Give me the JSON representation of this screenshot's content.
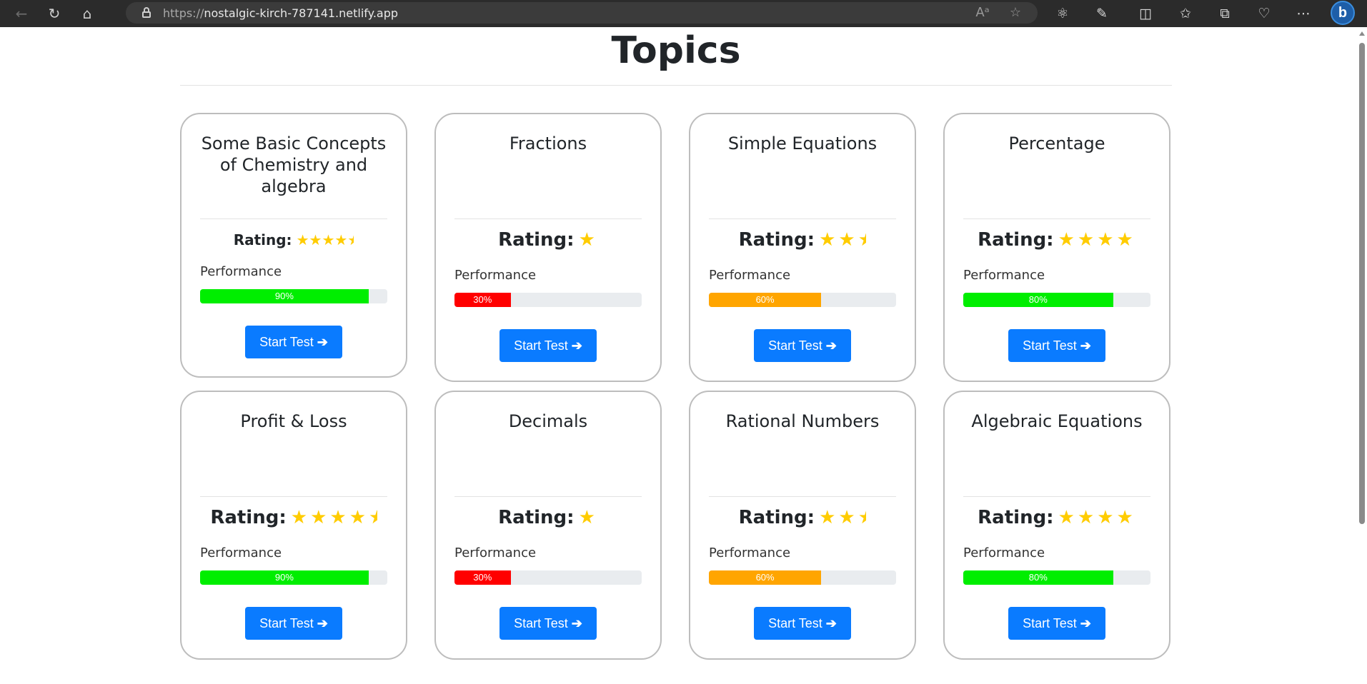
{
  "browser": {
    "url_scheme": "https://",
    "url_host": "nostalgic-kirch-787141.netlify.app"
  },
  "page": {
    "title": "Topics"
  },
  "cards": [
    {
      "title": "Some Basic Concepts of Chemistry and algebra",
      "rating_label": "Rating:",
      "rating": 4.5,
      "performance_label": "Performance",
      "performance": 90,
      "performance_text": "90%",
      "bar_color": "#00ee00",
      "button_label": "Start Test"
    },
    {
      "title": "Fractions",
      "rating_label": "Rating:",
      "rating": 1,
      "performance_label": "Performance",
      "performance": 30,
      "performance_text": "30%",
      "bar_color": "#ff0000",
      "button_label": "Start Test"
    },
    {
      "title": "Simple Equations",
      "rating_label": "Rating:",
      "rating": 2.5,
      "performance_label": "Performance",
      "performance": 60,
      "performance_text": "60%",
      "bar_color": "#ffa500",
      "button_label": "Start Test"
    },
    {
      "title": "Percentage",
      "rating_label": "Rating:",
      "rating": 4,
      "performance_label": "Performance",
      "performance": 80,
      "performance_text": "80%",
      "bar_color": "#00ee00",
      "button_label": "Start Test"
    },
    {
      "title": "Profit & Loss",
      "rating_label": "Rating:",
      "rating": 4.5,
      "performance_label": "Performance",
      "performance": 90,
      "performance_text": "90%",
      "bar_color": "#00ee00",
      "button_label": "Start Test"
    },
    {
      "title": "Decimals",
      "rating_label": "Rating:",
      "rating": 1,
      "performance_label": "Performance",
      "performance": 30,
      "performance_text": "30%",
      "bar_color": "#ff0000",
      "button_label": "Start Test"
    },
    {
      "title": "Rational Numbers",
      "rating_label": "Rating:",
      "rating": 2.5,
      "performance_label": "Performance",
      "performance": 60,
      "performance_text": "60%",
      "bar_color": "#ffa500",
      "button_label": "Start Test"
    },
    {
      "title": "Algebraic Equations",
      "rating_label": "Rating:",
      "rating": 4,
      "performance_label": "Performance",
      "performance": 80,
      "performance_text": "80%",
      "bar_color": "#00ee00",
      "button_label": "Start Test"
    }
  ]
}
